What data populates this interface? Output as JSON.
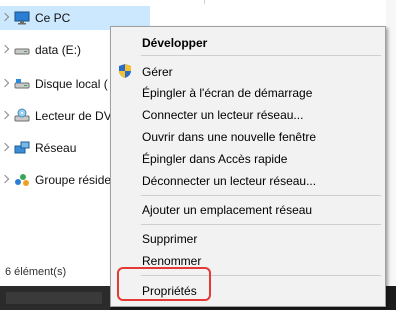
{
  "nav": {
    "items": [
      {
        "label": "Ce PC",
        "icon": "monitor-icon"
      },
      {
        "label": "data (E:)",
        "icon": "drive-icon"
      },
      {
        "label": "Disque local (",
        "icon": "drive-icon"
      },
      {
        "label": "Lecteur de DV",
        "icon": "dvd-icon"
      },
      {
        "label": "Réseau",
        "icon": "network-icon"
      },
      {
        "label": "Groupe réside",
        "icon": "homegroup-icon"
      }
    ]
  },
  "status": {
    "item_count": "6 élément(s)"
  },
  "context_menu": {
    "items": {
      "expand": "Développer",
      "manage": "Gérer",
      "pin_start": "Épingler à l'écran de démarrage",
      "map_drive": "Connecter un lecteur réseau...",
      "open_new_window": "Ouvrir dans une nouvelle fenêtre",
      "pin_quick": "Épingler dans Accès rapide",
      "disconnect_drive": "Déconnecter un lecteur réseau...",
      "add_network_location": "Ajouter un emplacement réseau",
      "delete": "Supprimer",
      "rename": "Renommer",
      "properties": "Propriétés"
    }
  },
  "colors": {
    "selection": "#cce8ff",
    "highlight_box": "#e53935",
    "menu_bg": "#f2f2f2"
  }
}
